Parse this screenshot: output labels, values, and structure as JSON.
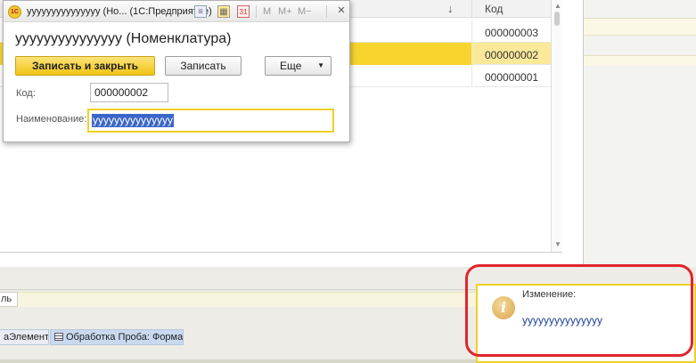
{
  "dialog": {
    "title": "yyyyyyyyyyyyyyy (Но...   (1С:Предприятие)",
    "heading": "yyyyyyyyyyyyyyy (Номенклатура)",
    "toolbar": {
      "mem_m": "M",
      "mem_mplus": "M+",
      "mem_mminus": "M−"
    },
    "buttons": {
      "save_close": "Записать и закрыть",
      "save": "Записать",
      "more": "Еще"
    },
    "fields": {
      "code_label": "Код:",
      "code_value": "000000002",
      "name_label": "Наименование:",
      "name_value": "yyyyyyyyyyyyyyy"
    }
  },
  "list": {
    "sort_indicator": "↓",
    "code_header": "Код",
    "rows": [
      {
        "code": "000000003",
        "selected": false
      },
      {
        "code": "000000002",
        "selected": true
      },
      {
        "code": "000000001",
        "selected": false
      }
    ]
  },
  "panel": {
    "tab_label": "ль"
  },
  "taskbar": {
    "tabs": [
      {
        "label": "аЭлемента"
      },
      {
        "label": "Обработка Проба: Форма"
      }
    ]
  },
  "notification": {
    "title": "Изменение:",
    "text": "yyyyyyyyyyyyyyy",
    "icon": "info-icon"
  },
  "colors": {
    "accent_yellow": "#f2c414",
    "selection": "#3a66c7",
    "highlight_ring": "#e0252c"
  }
}
